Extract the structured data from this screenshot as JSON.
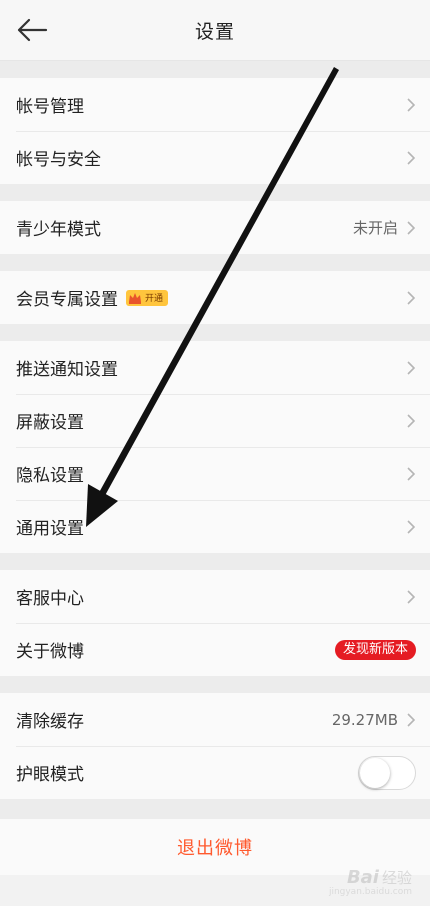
{
  "header": {
    "title": "设置",
    "back_icon": "arrow-left-icon"
  },
  "groups": {
    "account": {
      "items": [
        {
          "label": "帐号管理"
        },
        {
          "label": "帐号与安全"
        }
      ]
    },
    "teen": {
      "items": [
        {
          "label": "青少年模式",
          "value": "未开启"
        }
      ]
    },
    "vip": {
      "items": [
        {
          "label": "会员专属设置",
          "badge": "开通"
        }
      ]
    },
    "general": {
      "items": [
        {
          "label": "推送通知设置"
        },
        {
          "label": "屏蔽设置"
        },
        {
          "label": "隐私设置"
        },
        {
          "label": "通用设置"
        }
      ]
    },
    "service": {
      "items": [
        {
          "label": "客服中心"
        },
        {
          "label": "关于微博",
          "badge": "发现新版本"
        }
      ]
    },
    "misc": {
      "items": [
        {
          "label": "清除缓存",
          "value": "29.27MB"
        },
        {
          "label": "护眼模式",
          "toggle": false
        }
      ]
    }
  },
  "logout": {
    "label": "退出微博"
  },
  "watermark": {
    "logo": "Bai",
    "cn": "经验",
    "url": "jingyan.baidu.com"
  },
  "colors": {
    "logout": "#ff5a2e",
    "new_badge": "#e51c23",
    "vip_badge": "#ffc53d"
  }
}
